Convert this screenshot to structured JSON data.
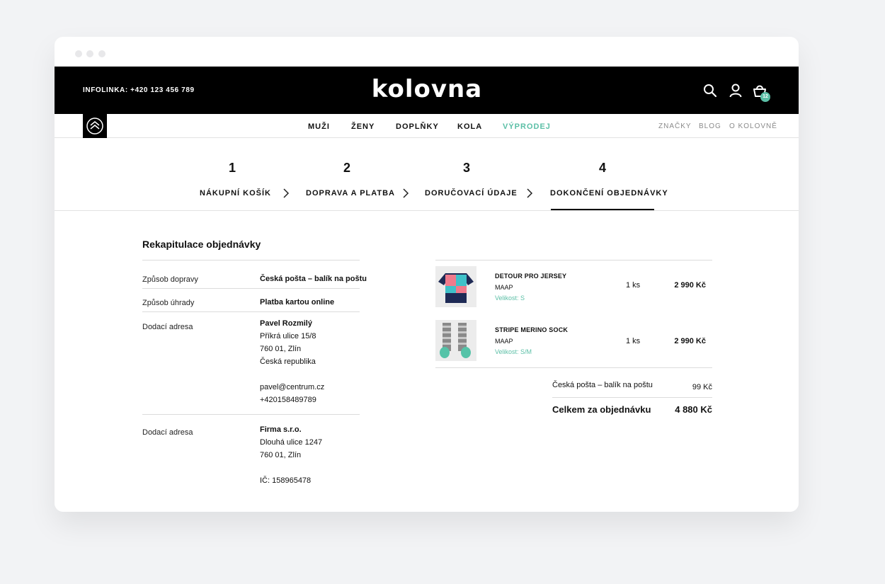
{
  "header": {
    "infoline": "INFOLINKA: +420 123 456 789",
    "logo": "kolovna",
    "cart_count": "12"
  },
  "nav": {
    "main": [
      "MUŽI",
      "ŽENY",
      "DOPLŇKY",
      "KOLA",
      "VÝPRODEJ"
    ],
    "secondary": [
      "ZNAČKY",
      "BLOG",
      "O KOLOVNĚ"
    ],
    "accent_color": "#5bbfa6"
  },
  "steps": [
    {
      "num": "1",
      "label": "NÁKUPNÍ KOŠÍK"
    },
    {
      "num": "2",
      "label": "DOPRAVA A PLATBA"
    },
    {
      "num": "3",
      "label": "DORUČOVACÍ ÚDAJE"
    },
    {
      "num": "4",
      "label": "DOKONČENÍ OBJEDNÁVKY"
    }
  ],
  "summary": {
    "title": "Rekapitulace objednávky",
    "shipping_method_label": "Způsob dopravy",
    "shipping_method_value": "Česká pošta – balík na poštu",
    "payment_method_label": "Způsob úhrady",
    "payment_method_value": "Platba kartou online",
    "delivery_address_label": "Dodací adresa",
    "delivery": {
      "name": "Pavel Rozmilý",
      "street": "Příkrá ulice 15/8",
      "city": "760 01, Zlín",
      "country": "Česká republika",
      "email": "pavel@centrum.cz",
      "phone": "+420158489789"
    },
    "billing_address_label": "Dodací adresa",
    "billing": {
      "company": "Firma s.r.o.",
      "street": "Dlouhá ulice 1247",
      "city": "760 01, Zlín",
      "ic": "IČ: 158965478"
    }
  },
  "items": [
    {
      "name": "DETOUR PRO JERSEY",
      "brand": "MAAP",
      "size": "Velikost: S",
      "qty": "1 ks",
      "price": "2 990 Kč"
    },
    {
      "name": "STRIPE MERINO SOCK",
      "brand": "MAAP",
      "size": "Velikost: S/M",
      "qty": "1 ks",
      "price": "2 990 Kč"
    }
  ],
  "totals": {
    "shipping_label": "Česká pošta – balík na poštu",
    "shipping_price": "99 Kč",
    "total_label": "Celkem za objednávku",
    "total_price": "4 880 Kč"
  }
}
